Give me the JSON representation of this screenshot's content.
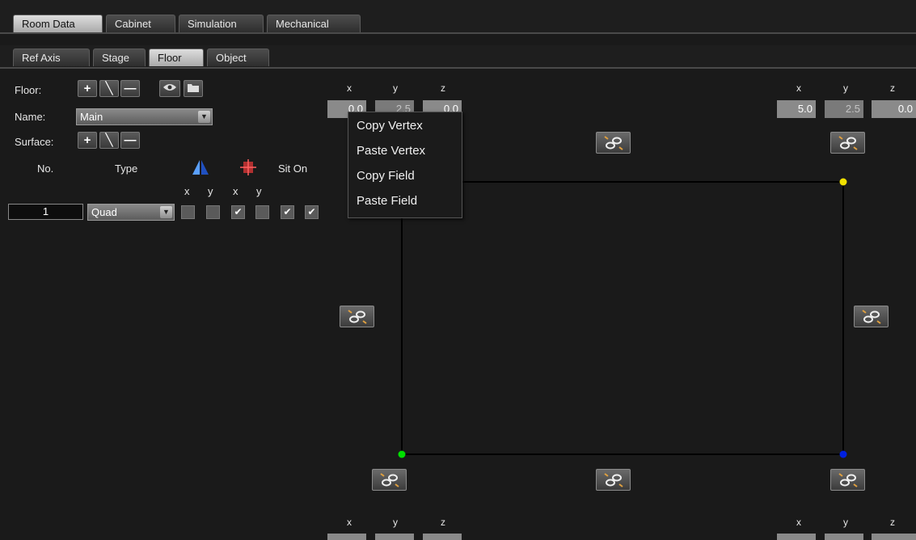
{
  "main_tabs": [
    "Room Data",
    "Cabinet",
    "Simulation",
    "Mechanical"
  ],
  "sub_tabs": [
    "Ref Axis",
    "Stage",
    "Floor",
    "Object"
  ],
  "floor_panel": {
    "floor_label": "Floor:",
    "name_label": "Name:",
    "name_value": "Main",
    "surface_label": "Surface:",
    "floor_tools": [
      "plus-icon",
      "slash-icon",
      "minus-icon",
      "eye-icon",
      "folder-icon"
    ],
    "surface_tools": [
      "plus-icon",
      "slash-icon",
      "minus-icon"
    ],
    "columns": {
      "no": "No.",
      "type": "Type",
      "sit_on": "Sit On",
      "x1": "x",
      "y1": "y",
      "x2": "x",
      "y2": "y"
    },
    "column_icons": [
      "mirror-icon",
      "crosshair-icon"
    ],
    "row": {
      "number": "1",
      "type": "Quad",
      "checks": [
        false,
        false,
        true,
        false,
        true,
        true
      ]
    }
  },
  "coords": {
    "top_left": {
      "x_label": "x",
      "y_label": "y",
      "z_label": "z",
      "x": "0.0",
      "y": "2.5",
      "z": "0.0"
    },
    "top_right": {
      "x_label": "x",
      "y_label": "y",
      "z_label": "z",
      "x": "5.0",
      "y": "2.5",
      "z": "0.0"
    },
    "bottom_left": {
      "x_label": "x",
      "y_label": "y",
      "z_label": "z"
    },
    "bottom_right": {
      "x_label": "x",
      "y_label": "y",
      "z_label": "z"
    }
  },
  "context_menu": [
    "Copy Vertex",
    "Paste Vertex",
    "Copy Field",
    "Paste Field"
  ],
  "vertex_colors": {
    "top_right": "#f0e000",
    "bottom_left": "#00e000",
    "bottom_right": "#0020e0"
  },
  "colors": {
    "background": "#1a1a1a",
    "active_tab": "#c8c8c8",
    "link_icon": "#e0a040"
  }
}
